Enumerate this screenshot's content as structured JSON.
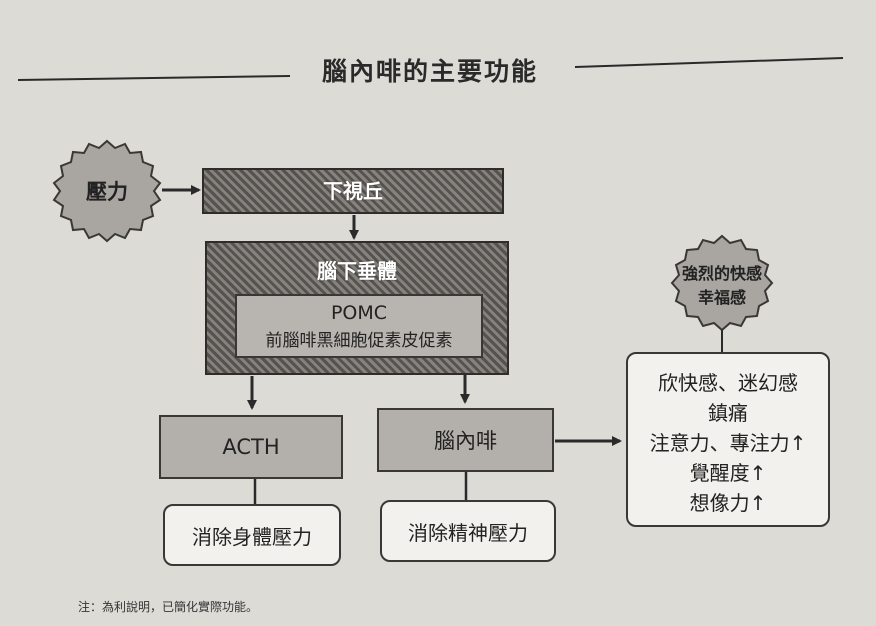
{
  "title": "腦內啡的主要功能",
  "stress": "壓力",
  "hypothalamus": "下視丘",
  "pituitary": "腦下垂體",
  "pomc": {
    "name": "POMC",
    "full": "前腦啡黑細胞促素皮促素"
  },
  "acth": "ACTH",
  "endorphin": "腦內啡",
  "relieve_body_stress": "消除身體壓力",
  "relieve_mental_stress": "消除精神壓力",
  "strong_feeling": [
    "強烈的快感",
    "幸福感"
  ],
  "effects": [
    "欣快感、迷幻感",
    "鎮痛",
    "注意力、專注力↑",
    "覺醒度↑",
    "想像力↑"
  ],
  "note": "注：為利說明，已簡化實際功能。"
}
